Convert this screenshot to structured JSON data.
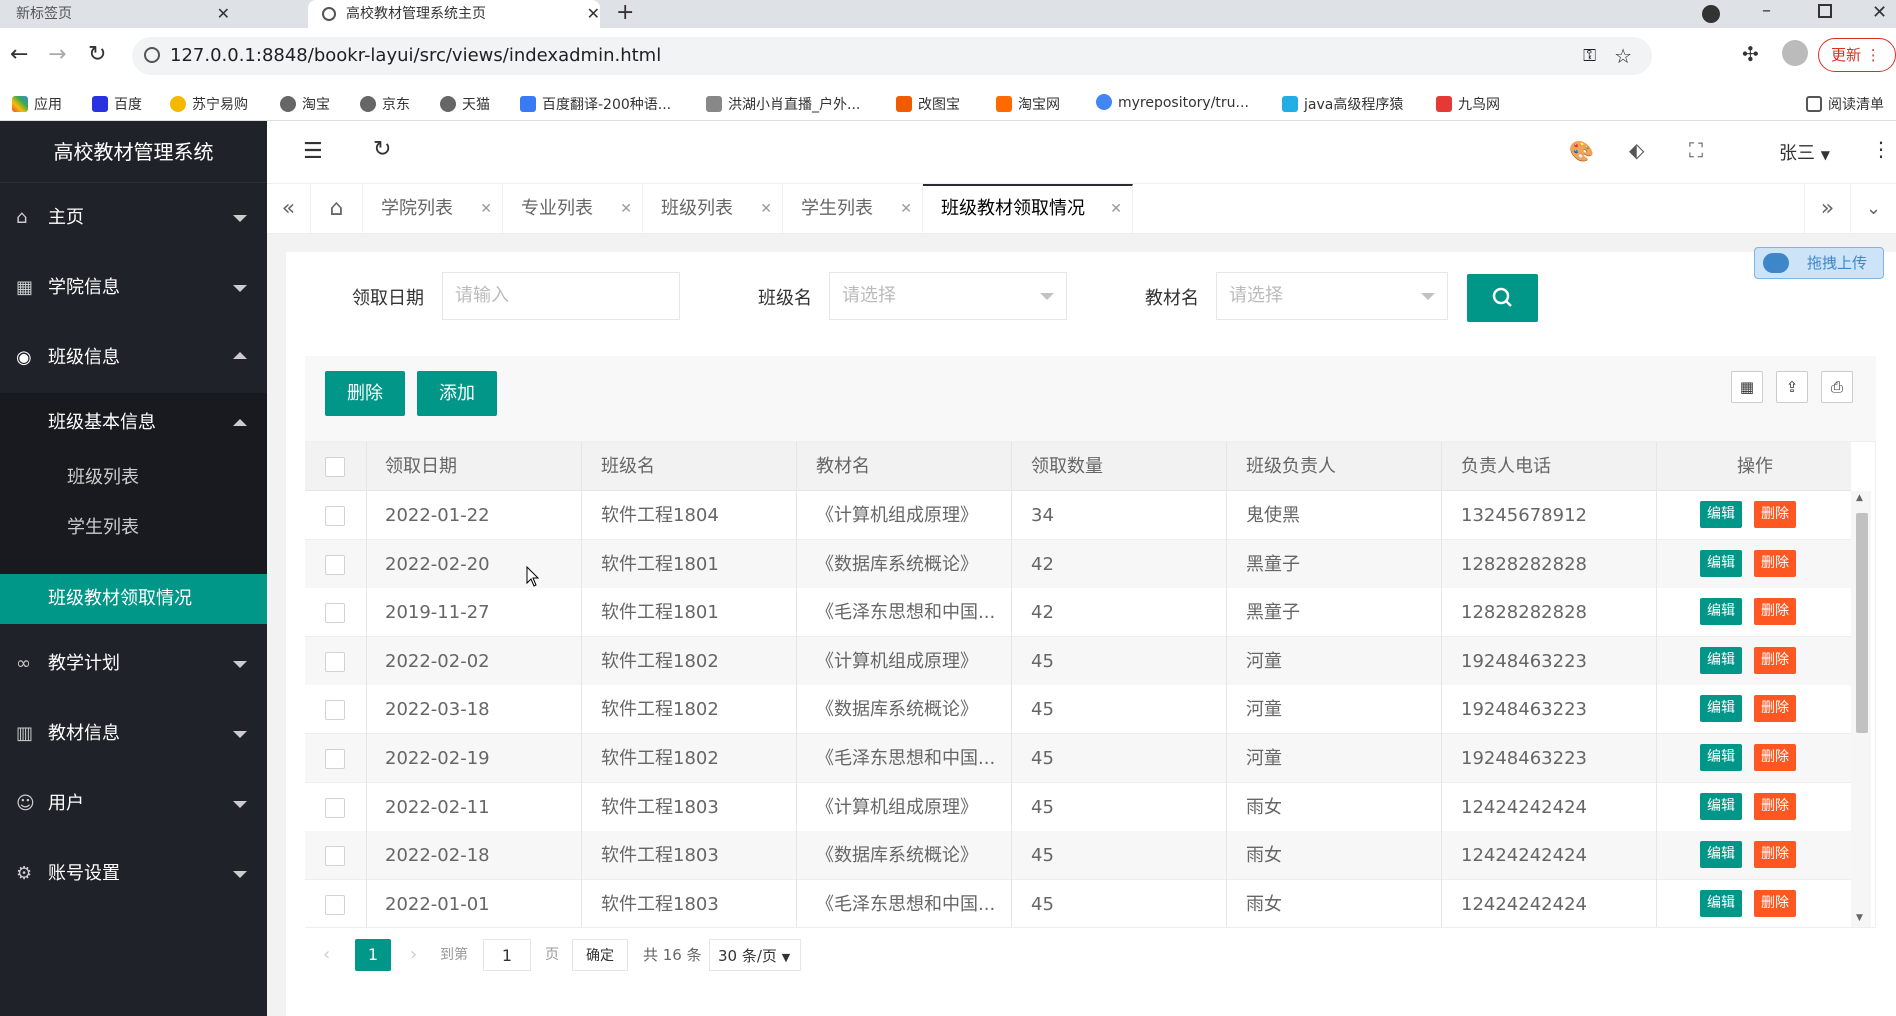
{
  "browser": {
    "tabs": [
      {
        "label": "新标签页"
      },
      {
        "label": "高校教材管理系统主页"
      }
    ],
    "url": "127.0.0.1:8848/bookr-layui/src/views/indexadmin.html",
    "update_label": "更新",
    "bookmarks": [
      "应用",
      "百度",
      "苏宁易购",
      "淘宝",
      "京东",
      "天猫",
      "百度翻译-200种语...",
      "洪湖小肖直播_户外...",
      "改图宝",
      "淘宝网",
      "myrepository/tru...",
      "java高级程序猿",
      "九鸟网"
    ],
    "reading_list": "阅读清单"
  },
  "sidebar": {
    "title": "高校教材管理系统",
    "items": [
      {
        "label": "主页",
        "icon": "home-icon"
      },
      {
        "label": "学院信息",
        "icon": "apps-icon"
      },
      {
        "label": "班级信息",
        "icon": "compass-icon"
      },
      {
        "label": "教学计划",
        "icon": "link-icon"
      },
      {
        "label": "教材信息",
        "icon": "book-icon"
      },
      {
        "label": "用户",
        "icon": "user-icon"
      },
      {
        "label": "账号设置",
        "icon": "gear-icon"
      }
    ],
    "sub_group": "班级基本信息",
    "sub_items": [
      "班级列表",
      "学生列表"
    ],
    "active_item": "班级教材领取情况"
  },
  "header": {
    "user": "张三"
  },
  "page_tabs": [
    "学院列表",
    "专业列表",
    "班级列表",
    "学生列表",
    "班级教材领取情况"
  ],
  "filters": {
    "date_label": "领取日期",
    "date_placeholder": "请输入",
    "class_label": "班级名",
    "class_placeholder": "请选择",
    "book_label": "教材名",
    "book_placeholder": "请选择"
  },
  "upload_label": "拖拽上传",
  "toolbar": {
    "delete_label": "删除",
    "add_label": "添加"
  },
  "table": {
    "columns": [
      "领取日期",
      "班级名",
      "教材名",
      "领取数量",
      "班级负责人",
      "负责人电话",
      "操作"
    ],
    "edit_label": "编辑",
    "delete_label": "删除",
    "rows": [
      {
        "date": "2022-01-22",
        "class": "软件工程1804",
        "book": "《计算机组成原理》",
        "qty": "34",
        "leader": "鬼使黑",
        "phone": "13245678912"
      },
      {
        "date": "2022-02-20",
        "class": "软件工程1801",
        "book": "《数据库系统概论》",
        "qty": "42",
        "leader": "黑童子",
        "phone": "12828282828"
      },
      {
        "date": "2019-11-27",
        "class": "软件工程1801",
        "book": "《毛泽东思想和中国...",
        "qty": "42",
        "leader": "黑童子",
        "phone": "12828282828"
      },
      {
        "date": "2022-02-02",
        "class": "软件工程1802",
        "book": "《计算机组成原理》",
        "qty": "45",
        "leader": "河童",
        "phone": "19248463223"
      },
      {
        "date": "2022-03-18",
        "class": "软件工程1802",
        "book": "《数据库系统概论》",
        "qty": "45",
        "leader": "河童",
        "phone": "19248463223"
      },
      {
        "date": "2022-02-19",
        "class": "软件工程1802",
        "book": "《毛泽东思想和中国...",
        "qty": "45",
        "leader": "河童",
        "phone": "19248463223"
      },
      {
        "date": "2022-02-11",
        "class": "软件工程1803",
        "book": "《计算机组成原理》",
        "qty": "45",
        "leader": "雨女",
        "phone": "12424242424"
      },
      {
        "date": "2022-02-18",
        "class": "软件工程1803",
        "book": "《数据库系统概论》",
        "qty": "45",
        "leader": "雨女",
        "phone": "12424242424"
      },
      {
        "date": "2022-01-01",
        "class": "软件工程1803",
        "book": "《毛泽东思想和中国...",
        "qty": "45",
        "leader": "雨女",
        "phone": "12424242424"
      }
    ]
  },
  "pager": {
    "current": "1",
    "goto_label": "到第",
    "page_value": "1",
    "page_unit": "页",
    "confirm": "确定",
    "total": "共 16 条",
    "per_page": "30 条/页"
  },
  "colors": {
    "accent": "#009688",
    "danger": "#ff5722",
    "sidebar": "#20222a"
  }
}
